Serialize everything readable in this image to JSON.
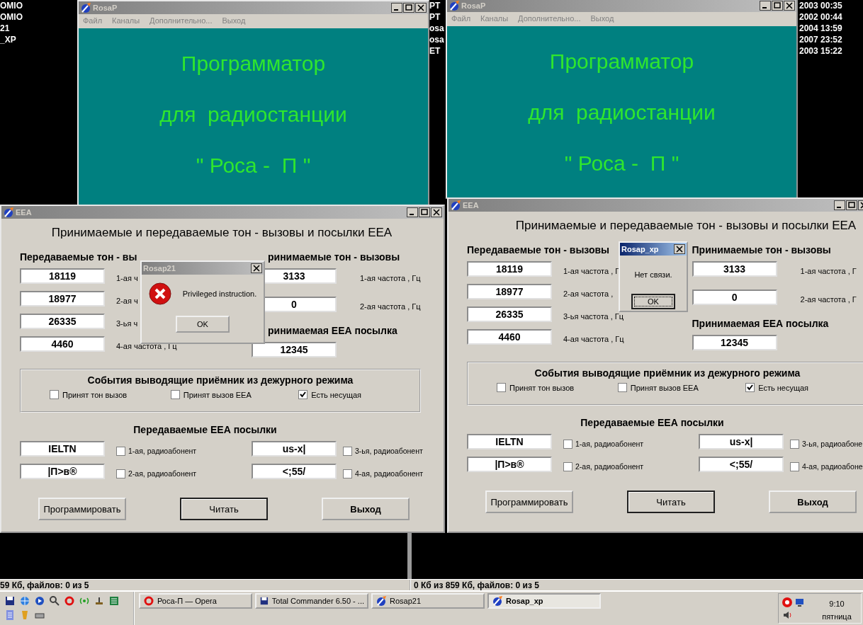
{
  "console": {
    "left_lines": [
      "OMIO",
      "OMIO",
      "21",
      "_XP"
    ],
    "middle_lines": [
      "PT",
      "PT",
      "osa",
      "osa",
      "ET"
    ],
    "right_lines": [
      "2003 00:35",
      "2002 00:44",
      "2004 13:59",
      "2007 23:52",
      "2003 15:22"
    ]
  },
  "programmer_windows": [
    {
      "title": "RosaP",
      "menu": [
        "Файл",
        "Каналы",
        "Дополнительно...",
        "Выход"
      ],
      "banner": [
        "Программатор",
        "для  радиостанции",
        "\" Роса -  П \""
      ]
    },
    {
      "title": "RosaP",
      "menu": [
        "Файл",
        "Каналы",
        "Дополнительно...",
        "Выход"
      ],
      "banner": [
        "Программатор",
        "для  радиостанции",
        "\" Роса -  П \""
      ]
    }
  ],
  "eea_windows": [
    {
      "title": "EEA",
      "heading": "Принимаемые и передаваемые тон - вызовы и посылки ЕЕА",
      "transmit_header": "Передаваемые тон - вы",
      "transmit_tones": [
        {
          "value": "18119",
          "label": "1-ая ч"
        },
        {
          "value": "18977",
          "label": "2-ая  ч"
        },
        {
          "value": "26335",
          "label": "3-ья ч"
        },
        {
          "value": "4460",
          "label": "4-ая частота , Гц"
        }
      ],
      "receive_header": "ринимаемые тон - вызовы",
      "receive_tones": [
        {
          "value": "3133",
          "label": "1-ая частота , Гц"
        },
        {
          "value": "0",
          "label": "2-ая частота , Гц"
        }
      ],
      "receive_eea_header": "ринимаемая ЕЕА посылка",
      "receive_eea_value": "12345",
      "events": {
        "title": "События выводящие приёмник из дежурного режима",
        "options": [
          {
            "label": "Принят тон вызов",
            "checked": false
          },
          {
            "label": "Принят вызов ЕЕА",
            "checked": false
          },
          {
            "label": "Есть несущая",
            "checked": true
          }
        ]
      },
      "packets_header": "Передаваемые ЕЕА посылки",
      "packets": [
        {
          "value": "IELTN",
          "checkbox": {
            "label": "1-ая, радиоабонент",
            "checked": false
          }
        },
        {
          "value": "|П>в®",
          "checkbox": {
            "label": "2-ая, радиоабонент",
            "checked": false
          }
        },
        {
          "value": "us-x|",
          "checkbox": {
            "label": "3-ья, радиоабонент",
            "checked": false
          }
        },
        {
          "value": "<;55/",
          "checkbox": {
            "label": "4-ая, радиоабонент",
            "checked": false
          }
        }
      ],
      "buttons": [
        {
          "label": "Программировать",
          "kind": "plain"
        },
        {
          "label": "Читать",
          "kind": "default"
        },
        {
          "label": "Выход",
          "kind": "bold"
        }
      ],
      "dialog": {
        "title": "Rosap21",
        "active": false,
        "kind": "error",
        "message": "Privileged instruction.",
        "button": "OK",
        "button_focused": false
      }
    },
    {
      "title": "EEA",
      "heading": "Принимаемые и передаваемые тон - вызовы и посылки ЕЕА",
      "transmit_header": "Передаваемые тон - вызовы",
      "transmit_tones": [
        {
          "value": "18119",
          "label": "1-ая частота , Г"
        },
        {
          "value": "18977",
          "label": "2-ая  частота ,"
        },
        {
          "value": "26335",
          "label": "3-ья частота , Гц"
        },
        {
          "value": "4460",
          "label": "4-ая частота , Гц"
        }
      ],
      "receive_header": "Принимаемые тон - вызовы",
      "receive_tones": [
        {
          "value": "3133",
          "label": "1-ая частота , Г"
        },
        {
          "value": "0",
          "label": "2-ая частота , Г"
        }
      ],
      "receive_eea_header": "Принимаемая ЕЕА посылка",
      "receive_eea_value": "12345",
      "events": {
        "title": "События выводящие приёмник из дежурного режима",
        "options": [
          {
            "label": "Принят тон вызов",
            "checked": false
          },
          {
            "label": "Принят вызов ЕЕА",
            "checked": false
          },
          {
            "label": "Есть несущая",
            "checked": true
          }
        ]
      },
      "packets_header": "Передаваемые ЕЕА посылки",
      "packets": [
        {
          "value": "IELTN",
          "checkbox": {
            "label": "1-ая, радиоабонент",
            "checked": false
          }
        },
        {
          "value": "|П>в®",
          "checkbox": {
            "label": "2-ая, радиоабонент",
            "checked": false
          }
        },
        {
          "value": "us-x|",
          "checkbox": {
            "label": "3-ья, радиоабоне",
            "checked": false
          }
        },
        {
          "value": "<;55/",
          "checkbox": {
            "label": "4-ая, радиоабоне",
            "checked": false
          }
        }
      ],
      "buttons": [
        {
          "label": "Программировать",
          "kind": "plain"
        },
        {
          "label": "Читать",
          "kind": "default"
        },
        {
          "label": "Выход",
          "kind": "bold"
        }
      ],
      "dialog": {
        "title": "Rosap_xp",
        "active": true,
        "kind": "plain",
        "message": "Нет связи.",
        "button": "OK",
        "button_focused": true
      }
    }
  ],
  "status_bar": [
    "59 Кб, файлов: 0 из 5",
    "0 Кб из 859 Кб, файлов: 0 из 5"
  ],
  "taskbar": {
    "tasks": [
      {
        "label": "Роса-П — Opera",
        "kind": "opera",
        "selected": false
      },
      {
        "label": "Total Commander 6.50 - ...",
        "kind": "disk",
        "selected": false
      },
      {
        "label": "Rosap21",
        "kind": "app",
        "selected": false
      },
      {
        "label": "Rosap_xp",
        "kind": "app",
        "selected": true
      }
    ],
    "clock": {
      "time": "9:10",
      "day": "пятница"
    }
  }
}
